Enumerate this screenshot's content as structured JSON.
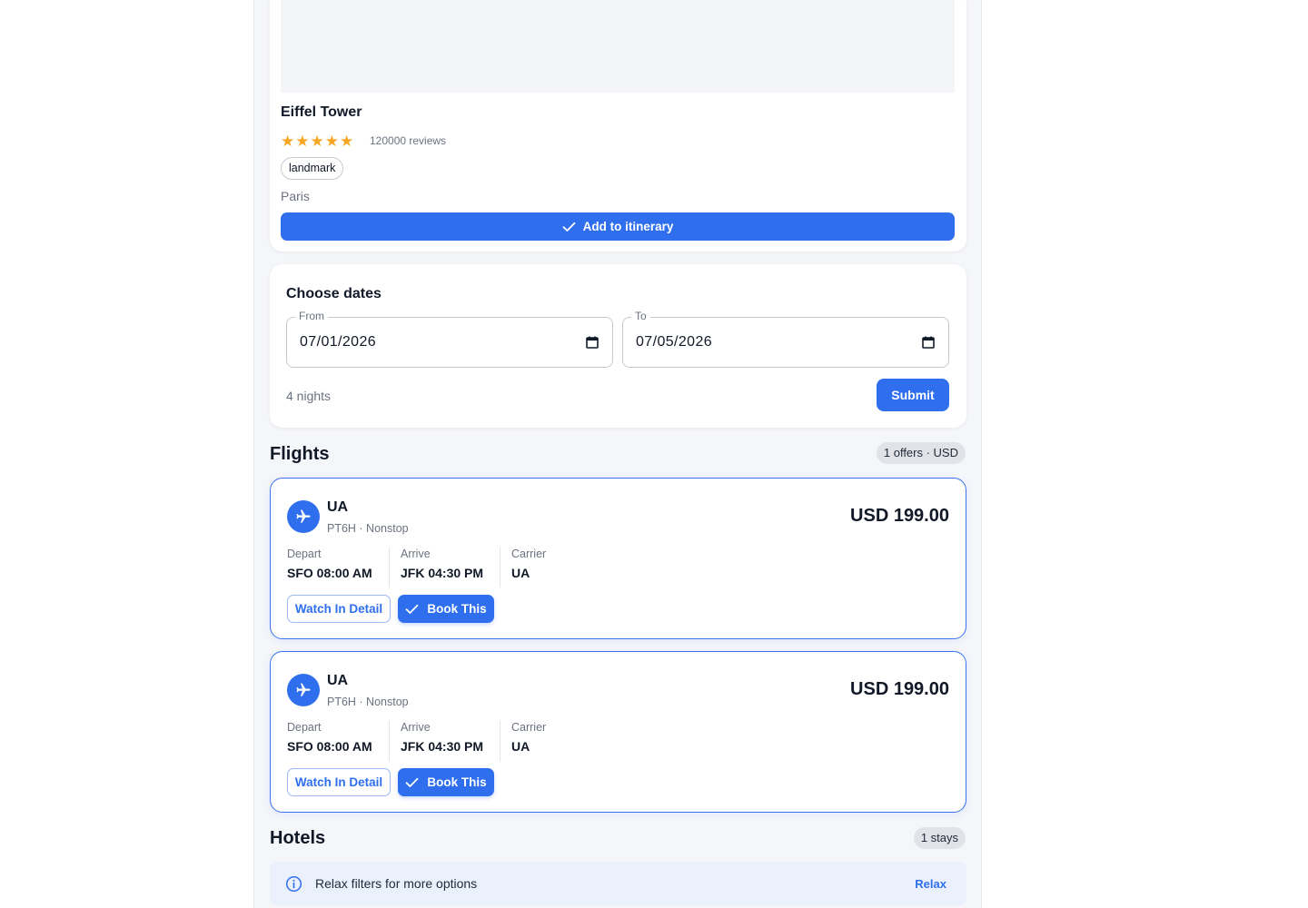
{
  "attraction": {
    "title": "Eiffel Tower",
    "rating_stars": 5,
    "reviews": "120000 reviews",
    "tag": "landmark",
    "city": "Paris",
    "add_label": "Add to itinerary"
  },
  "dates": {
    "title": "Choose dates",
    "from_label": "From",
    "from_value": "07/01/2026",
    "to_label": "To",
    "to_value": "07/05/2026",
    "nights": "4 nights",
    "submit_label": "Submit"
  },
  "flights": {
    "title": "Flights",
    "badge": "1 offers · USD",
    "cards": [
      {
        "airline": "UA",
        "sub": "PT6H · Nonstop",
        "price": "USD 199.00",
        "depart_label": "Depart",
        "depart_value": "SFO 08:00 AM",
        "arrive_label": "Arrive",
        "arrive_value": "JFK 04:30 PM",
        "carrier_label": "Carrier",
        "carrier_value": "UA",
        "watch_label": "Watch In Detail",
        "book_label": "Book This"
      },
      {
        "airline": "UA",
        "sub": "PT6H · Nonstop",
        "price": "USD 199.00",
        "depart_label": "Depart",
        "depart_value": "SFO 08:00 AM",
        "arrive_label": "Arrive",
        "arrive_value": "JFK 04:30 PM",
        "carrier_label": "Carrier",
        "carrier_value": "UA",
        "watch_label": "Watch In Detail",
        "book_label": "Book This"
      }
    ]
  },
  "hotels": {
    "title": "Hotels",
    "badge": "1 stays",
    "notice": "Relax filters for more options",
    "relax_label": "Relax"
  },
  "colors": {
    "accent": "#2f6fee",
    "star": "#f5a623",
    "page_bg": "#f5f6fa",
    "notice_bg": "#eaf0fc"
  }
}
